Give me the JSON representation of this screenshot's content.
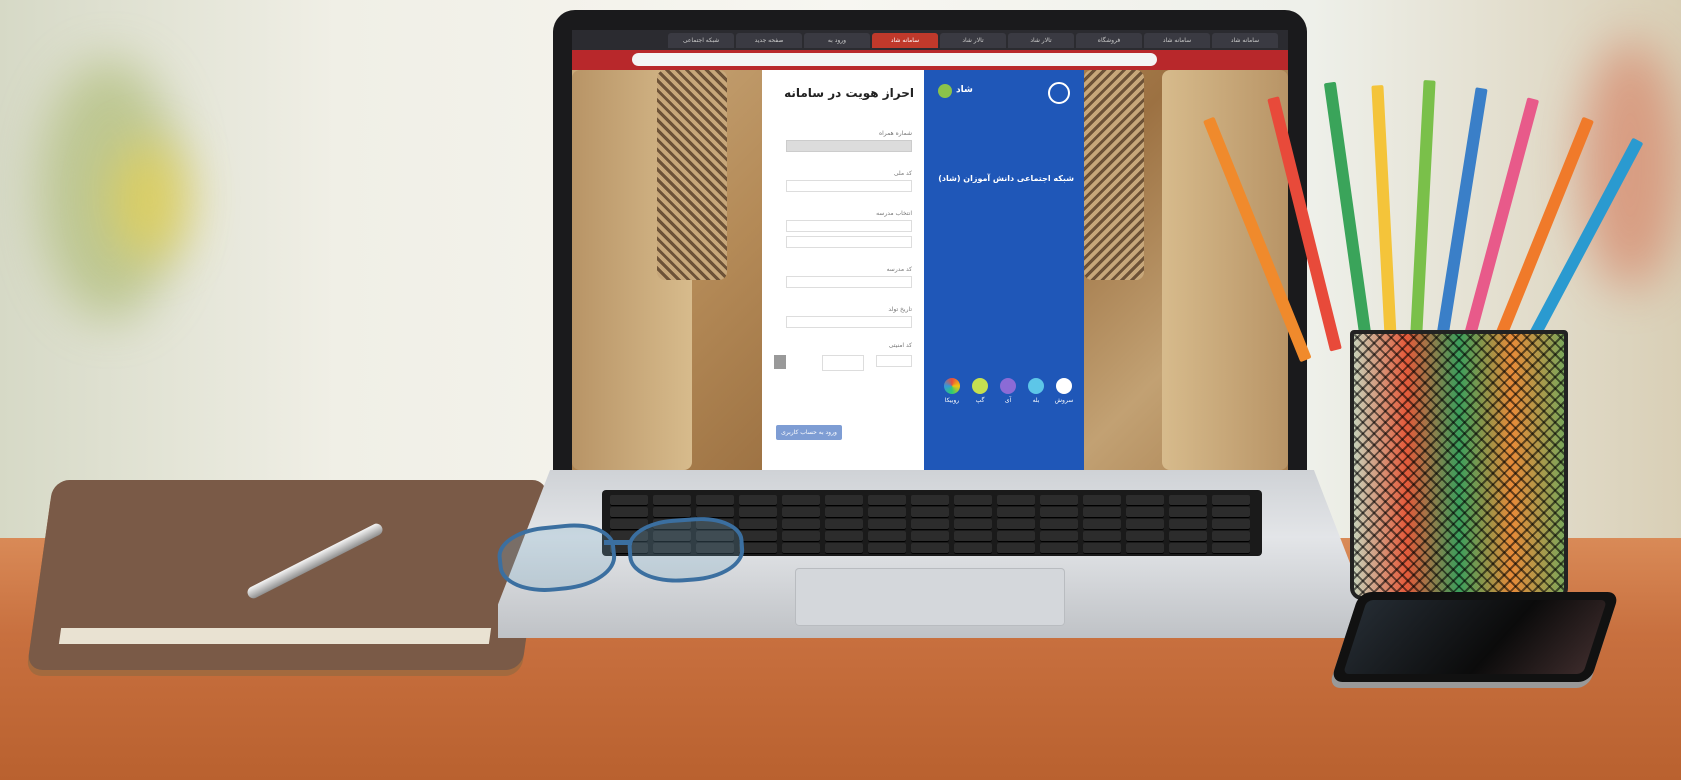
{
  "browser": {
    "tabs": [
      "سامانه شاد",
      "سامانه شاد",
      "فروشگاه",
      "تالار شاد",
      "تالار شاد",
      "سامانه شاد",
      "ورود به",
      "صفحه جدید",
      "شبکه اجتماعی"
    ],
    "active_tab_index": 5,
    "url": ""
  },
  "login_form": {
    "title": "احراز هویت در سامانه",
    "fields": [
      {
        "label": "شماره همراه",
        "value": ""
      },
      {
        "label": "کد ملی",
        "value": ""
      },
      {
        "label": "انتخاب مدرسه",
        "value": ""
      },
      {
        "label": "کد مدرسه",
        "value": ""
      },
      {
        "label": "تاریخ تولد",
        "value": ""
      }
    ],
    "captcha_label": "کد امنیتی",
    "captcha_text": "",
    "submit_label": "ورود به حساب کاربری"
  },
  "info_panel": {
    "logo_text": "شاد",
    "heading": "شبکه اجتماعی دانش آموزان (شاد)",
    "description": "",
    "apps": [
      "سروش",
      "بله",
      "آی",
      "گپ",
      "روبیکا"
    ]
  },
  "colors": {
    "browser_accent": "#b8282b",
    "panel_blue": "#1f57b8",
    "submit_button": "#7e9dd4"
  }
}
